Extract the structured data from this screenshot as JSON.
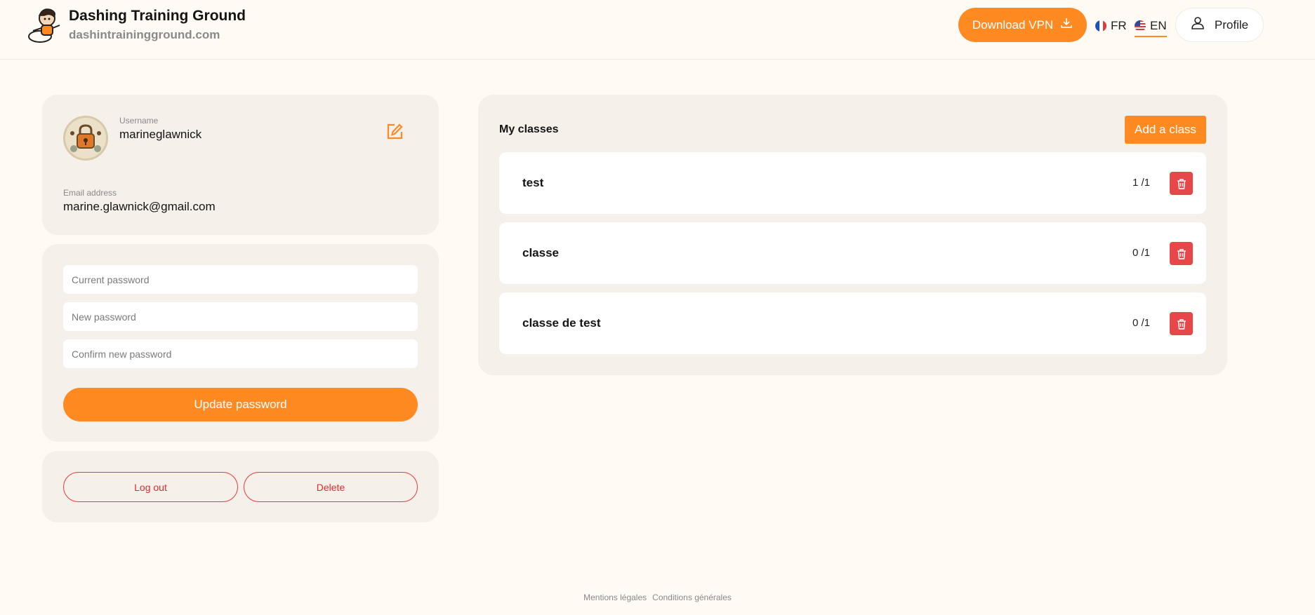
{
  "header": {
    "brand_title": "Dashing Training Ground",
    "brand_domain": "dashintrainingground.com",
    "vpn_label": "Download VPN",
    "lang_fr": "FR",
    "lang_en": "EN",
    "profile_label": "Profile",
    "accent_color": "#ff8a22"
  },
  "user": {
    "username_label": "Username",
    "username": "marineglawnick",
    "email_label": "Email address",
    "email": "marine.glawnick@gmail.com"
  },
  "password": {
    "current_placeholder": "Current password",
    "new_placeholder": "New password",
    "confirm_placeholder": "Confirm new password",
    "update_label": "Update password"
  },
  "account_actions": {
    "logout_label": "Log out",
    "delete_label": "Delete"
  },
  "classes": {
    "title": "My classes",
    "add_label": "Add a class",
    "items": [
      {
        "name": "test",
        "count": "1 /1"
      },
      {
        "name": "classe",
        "count": "0 /1"
      },
      {
        "name": "classe de test",
        "count": "0 /1"
      }
    ]
  },
  "footer": {
    "legal": "Mentions légales",
    "terms": "Conditions générales"
  },
  "icons": {
    "logo": "character-mascot-icon",
    "vpn": "download-icon",
    "profile": "user-icon",
    "edit": "edit-icon",
    "delete_class": "trash-icon"
  },
  "colors": {
    "background": "#fffaf4",
    "card": "#f5f0ea",
    "danger": "#e8474a"
  }
}
